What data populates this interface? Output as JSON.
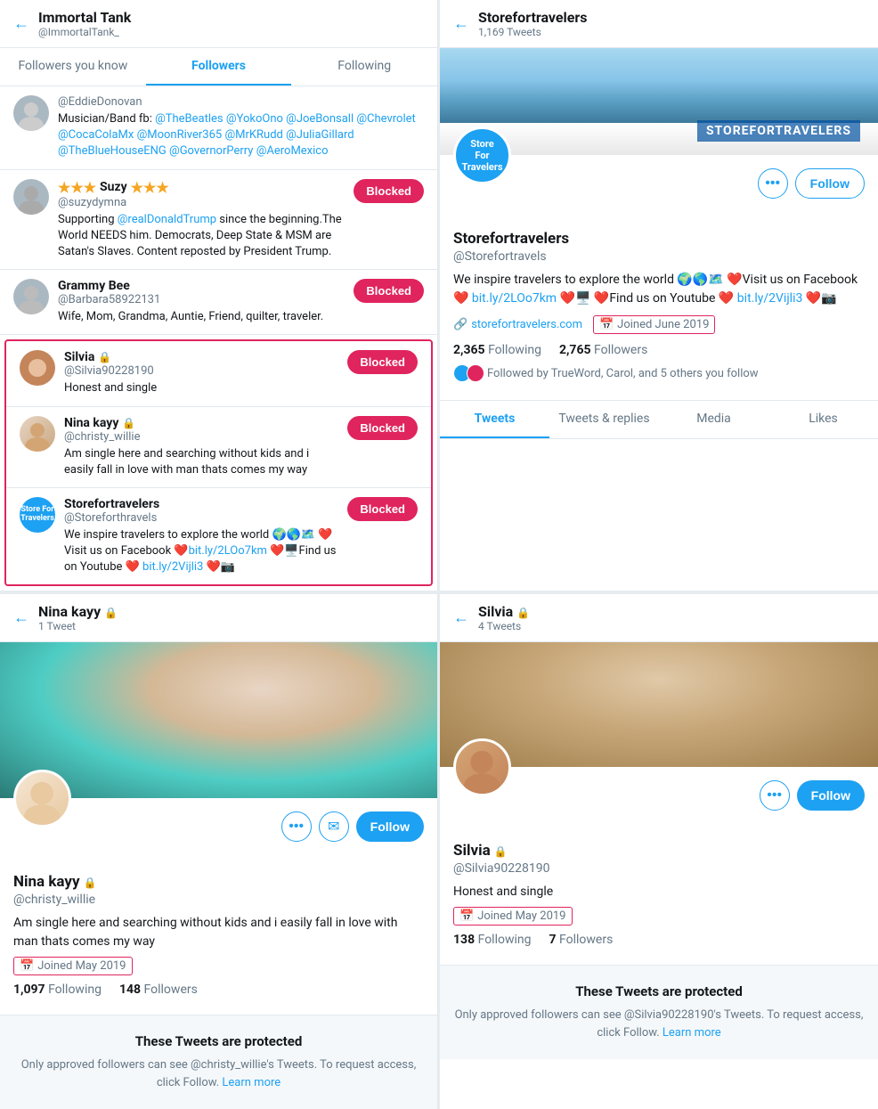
{
  "left_panel": {
    "title": "Immortal Tank",
    "handle": "@ImmortalTank_",
    "tabs": [
      "Followers you know",
      "Followers",
      "Following"
    ],
    "active_tab": 1,
    "followers": [
      {
        "id": "eddieDonovan",
        "handle": "@EddieDonovan",
        "bio": "Musician/Band fb: @TheBeatles @YokoOno @JoeBonsall @Chevrolet @CocaColaMx @MoonRiver365 @MrKRudd @JuliaGillard @TheBlueHouseENG @GovernorPerry @AeroMexico",
        "avatar_color": "gray",
        "blocked": false,
        "stars": null
      },
      {
        "id": "suzy",
        "name": "Suzy",
        "handle": "@suzydymna",
        "bio": "Supporting @realDonaldTrump since the beginning.The World NEEDS him. Democrats, Deep State & MSM are Satan's Slaves. Content reposted by President Trump.",
        "avatar_color": "gray",
        "blocked": true,
        "stars": "★★★"
      },
      {
        "id": "grammyBee",
        "name": "Grammy Bee",
        "handle": "@Barbara58922131",
        "bio": "Wife, Mom, Grandma, Auntie, Friend, quilter, traveler.",
        "avatar_color": "gray",
        "blocked": true,
        "stars": null
      }
    ],
    "highlighted_group": [
      {
        "id": "silvia",
        "name": "Silvia",
        "handle": "@Silvia90228190",
        "bio": "Honest and single",
        "avatar_color": "silvia",
        "blocked": true,
        "lock": true
      },
      {
        "id": "ninaKayy",
        "name": "Nina kayy",
        "handle": "@christy_willie",
        "bio": "Am single here and searching without kids and i easily fall in love with man thats comes my way",
        "avatar_color": "nina",
        "blocked": true,
        "lock": true
      },
      {
        "id": "storefortravelers",
        "name": "Storefortravelers",
        "handle": "@Storeforthravels",
        "bio": "We inspire travelers to explore the world 🌍🌎🗺️ ❤️Visit us on Facebook ❤️bit.ly/2LOo7km ❤️🖥️Find us on Youtube ❤️bit.ly/2Vijli3 ❤️📷",
        "avatar_color": "store",
        "blocked": true,
        "lock": false
      }
    ],
    "blocked_label": "Blocked"
  },
  "right_panel": {
    "title": "Storefortravelers",
    "tweet_count": "1,169 Tweets",
    "name": "Storefortravelers",
    "handle": "@Storefortravels",
    "bio": "We inspire travelers to explore the world 🌍🌎🗺️ ❤️Visit us on Facebook ❤️ bit.ly/2LOo7km ❤️🖥️ ❤️Find us on Youtube ❤️ bit.ly/2Vijli3 ❤️📷",
    "website": "storefortravelers.com",
    "joined": "Joined June 2019",
    "following": "2,365",
    "followers": "2,765",
    "following_label": "Following",
    "followers_label": "Followers",
    "followed_by": "Followed by TrueWord, Carol, and 5 others you follow",
    "tabs": [
      "Tweets",
      "Tweets & replies",
      "Media",
      "Likes"
    ],
    "active_tab": 0,
    "cover_label": "STOREFORTRAVELERS",
    "more_label": "•••",
    "follow_label": "Follow"
  },
  "bottom_left": {
    "title": "Nina kayy",
    "lock": true,
    "tweet_count": "1 Tweet",
    "name": "Nina kayy",
    "handle": "@christy_willie",
    "bio": "Am single here and searching without kids and i easily fall in love with man thats comes my way",
    "joined": "Joined May 2019",
    "following": "1,097",
    "followers": "148",
    "following_label": "Following",
    "followers_label": "Followers",
    "more_label": "•••",
    "email_label": "✉",
    "follow_label": "Follow",
    "protected_title": "These Tweets are protected",
    "protected_text": "Only approved followers can see @christy_willie's Tweets. To request access, click Follow.",
    "learn_more": "Learn more"
  },
  "bottom_right": {
    "title": "Silvia",
    "lock": true,
    "tweet_count": "4 Tweets",
    "name": "Silvia",
    "handle": "@Silvia90228190",
    "bio": "Honest and single",
    "joined": "Joined May 2019",
    "following": "138",
    "followers": "7",
    "following_label": "Following",
    "followers_label": "Followers",
    "more_label": "•••",
    "follow_label": "Follow",
    "protected_title": "These Tweets are protected",
    "protected_text": "Only approved followers can see @Silvia90228190's Tweets. To request access, click Follow.",
    "learn_more": "Learn more"
  }
}
